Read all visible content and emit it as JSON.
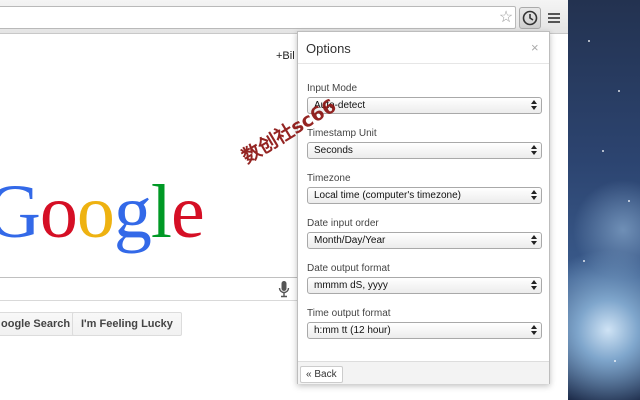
{
  "google": {
    "plus_link": "+Bil",
    "logo_letters": [
      "G",
      "o",
      "o",
      "g",
      "l",
      "e"
    ],
    "search_button": "oogle Search",
    "lucky_button": "I'm Feeling Lucky"
  },
  "options": {
    "title": "Options",
    "close": "×",
    "fields": [
      {
        "label": "Input Mode",
        "value": "Auto-detect"
      },
      {
        "label": "Timestamp Unit",
        "value": "Seconds"
      },
      {
        "label": "Timezone",
        "value": "Local time (computer's timezone)"
      },
      {
        "label": "Date input order",
        "value": "Month/Day/Year"
      },
      {
        "label": "Date output format",
        "value": "mmmm dS, yyyy"
      },
      {
        "label": "Time output format",
        "value": "h:mm tt (12 hour)"
      }
    ],
    "back_button": "« Back"
  },
  "watermark": "数创社sc66",
  "icons": {
    "bookmark": "star-icon",
    "extension": "clock-icon",
    "menu": "hamburger-menu-icon",
    "voice": "microphone-icon"
  }
}
